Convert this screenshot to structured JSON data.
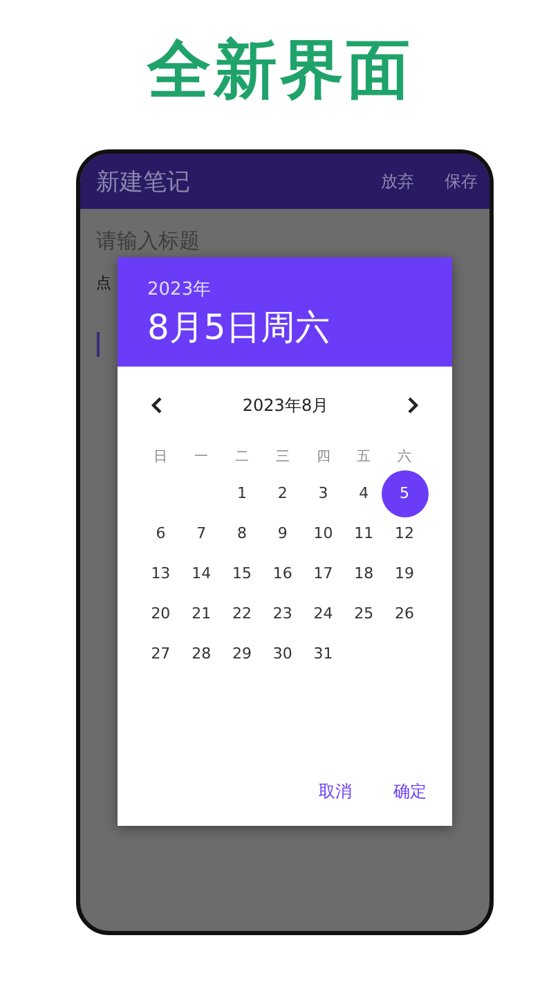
{
  "banner": {
    "title": "全新界面"
  },
  "app_bar": {
    "title": "新建笔记",
    "actions": [
      "放弃",
      "保存"
    ]
  },
  "editor": {
    "title_placeholder": "请输入标题",
    "hint": "点"
  },
  "date_dialog": {
    "year": "2023年",
    "date": "8月5日周六",
    "month": "2023年8月",
    "weekdays": [
      "日",
      "一",
      "二",
      "三",
      "四",
      "五",
      "六"
    ],
    "weeks": [
      {
        "kind": "partial",
        "days": [
          {
            "label": "1",
            "selected": false
          },
          {
            "label": "2",
            "selected": false
          },
          {
            "label": "3",
            "selected": false
          },
          {
            "label": "4",
            "selected": false
          },
          {
            "label": "5",
            "selected": true
          }
        ]
      },
      {
        "kind": "full",
        "days": [
          {
            "label": "6",
            "selected": false
          },
          {
            "label": "7",
            "selected": false
          },
          {
            "label": "8",
            "selected": false
          },
          {
            "label": "9",
            "selected": false
          },
          {
            "label": "10",
            "selected": false
          },
          {
            "label": "11",
            "selected": false
          },
          {
            "label": "12",
            "selected": false
          }
        ]
      },
      {
        "kind": "full",
        "days": [
          {
            "label": "13",
            "selected": false
          },
          {
            "label": "14",
            "selected": false
          },
          {
            "label": "15",
            "selected": false
          },
          {
            "label": "16",
            "selected": false
          },
          {
            "label": "17",
            "selected": false
          },
          {
            "label": "18",
            "selected": false
          },
          {
            "label": "19",
            "selected": false
          }
        ]
      },
      {
        "kind": "full",
        "days": [
          {
            "label": "20",
            "selected": false
          },
          {
            "label": "21",
            "selected": false
          },
          {
            "label": "22",
            "selected": false
          },
          {
            "label": "23",
            "selected": false
          },
          {
            "label": "24",
            "selected": false
          },
          {
            "label": "25",
            "selected": false
          },
          {
            "label": "26",
            "selected": false
          }
        ]
      },
      {
        "kind": "full",
        "days": [
          {
            "label": "27",
            "selected": false
          },
          {
            "label": "28",
            "selected": false
          },
          {
            "label": "29",
            "selected": false
          },
          {
            "label": "30",
            "selected": false
          },
          {
            "label": "31",
            "selected": false
          }
        ]
      }
    ],
    "buttons": [
      "取消",
      "确定"
    ]
  }
}
